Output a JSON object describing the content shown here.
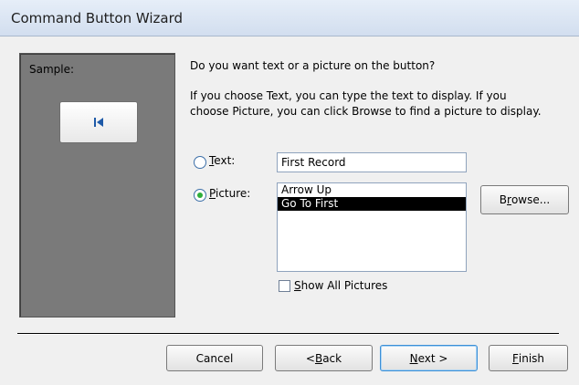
{
  "window": {
    "title": "Command Button Wizard"
  },
  "sample": {
    "label": "Sample:",
    "preview_icon": "go-to-first-icon"
  },
  "prompt": "Do you want text or a picture on the button?",
  "explanation": {
    "line1": "If you choose Text, you can type the text to display.  If you",
    "line2": "choose Picture, you can click Browse to find a picture to display."
  },
  "options": {
    "text": {
      "mnemonic": "T",
      "rest": "ext:",
      "selected": false,
      "value": "First Record"
    },
    "picture": {
      "mnemonic": "P",
      "rest": "icture:",
      "selected": true,
      "items": [
        "Arrow Up",
        "Go To First"
      ],
      "selected_item": "Go To First"
    }
  },
  "browse": {
    "pre": "B",
    "mnemonic": "r",
    "post": "owse..."
  },
  "show_all": {
    "mnemonic": "S",
    "rest": "how All Pictures",
    "checked": false
  },
  "buttons": {
    "cancel": {
      "label": "Cancel"
    },
    "back": {
      "pre": "< ",
      "mnemonic": "B",
      "post": "ack"
    },
    "next": {
      "pre": "",
      "mnemonic": "N",
      "post": "ext >"
    },
    "finish": {
      "pre": "",
      "mnemonic": "F",
      "post": "inish"
    }
  }
}
